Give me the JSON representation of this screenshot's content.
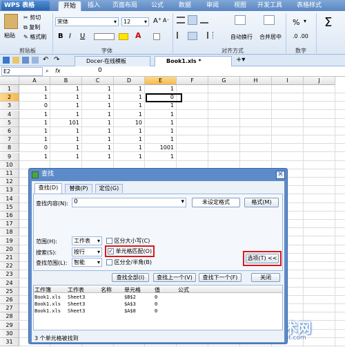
{
  "app": {
    "name": "WPS 表格"
  },
  "ribbon_tabs": [
    "开始",
    "插入",
    "页面布局",
    "公式",
    "数据",
    "审阅",
    "视图",
    "开发工具",
    "表格样式"
  ],
  "ribbon": {
    "paste": "粘贴",
    "cut": "剪切",
    "copy": "复制",
    "format_painter": "格式刷",
    "clipboard_group": "剪贴板",
    "font_group": "字体",
    "align_group": "对齐方式",
    "number_group": "数字",
    "font_name": "宋体",
    "font_size": "12",
    "bold": "B",
    "italic": "I",
    "underline": "U",
    "font_color": "A",
    "wrap": "自动换行",
    "merge": "合并居中",
    "percent": "%",
    "sum": "Σ"
  },
  "doc_tabs": [
    "Docer-在线模板",
    "Book1.xls *"
  ],
  "formula_bar": {
    "name_box": "E2",
    "fx": "fx",
    "value": "0"
  },
  "sheet": {
    "columns": [
      "A",
      "B",
      "C",
      "D",
      "E",
      "F",
      "G",
      "H",
      "I",
      "J"
    ],
    "rows": [
      "1",
      "2",
      "3",
      "4",
      "5",
      "6",
      "7",
      "8",
      "9",
      "10",
      "11",
      "12",
      "13",
      "14",
      "15",
      "16",
      "17",
      "18",
      "19",
      "20",
      "21",
      "22",
      "23",
      "24",
      "25",
      "26",
      "27",
      "28",
      "29",
      "30",
      "31"
    ],
    "data": [
      [
        "1",
        "1",
        "1",
        "1",
        "1"
      ],
      [
        "1",
        "1",
        "1",
        "1",
        "0"
      ],
      [
        "0",
        "1",
        "1",
        "1",
        "1"
      ],
      [
        "1",
        "1",
        "1",
        "1",
        "1"
      ],
      [
        "1",
        "101",
        "1",
        "10",
        "1"
      ],
      [
        "1",
        "1",
        "1",
        "1",
        "1"
      ],
      [
        "1",
        "1",
        "1",
        "1",
        "1"
      ],
      [
        "0",
        "1",
        "1",
        "1",
        "1001"
      ],
      [
        "1",
        "1",
        "1",
        "1",
        "1"
      ]
    ]
  },
  "dialog": {
    "title": "查找",
    "tabs": [
      "查找(D)",
      "替换(P)",
      "定位(G)"
    ],
    "find_label": "查找内容(N):",
    "find_value": "0",
    "no_format": "未设定格式",
    "format_btn": "格式(M)",
    "scope_label": "范围(H):",
    "scope_value": "工作表",
    "search_label": "搜索(S):",
    "search_value": "按行",
    "lookin_label": "查找范围(L):",
    "lookin_value": "智能",
    "match_case": "区分大小写(C)",
    "match_cell": "单元格匹配(O)",
    "match_width": "区分全/半角(B)",
    "options_btn": "选项(T) <<",
    "find_all": "查找全部(I)",
    "find_prev": "查找上一个(V)",
    "find_next": "查找下一个(F)",
    "close": "关闭",
    "result_headers": [
      "工作簿",
      "工作表",
      "名称",
      "单元格",
      "值",
      "公式"
    ],
    "results": [
      [
        "Book1.xls",
        "Sheet3",
        "",
        "$B$2",
        "0",
        ""
      ],
      [
        "Book1.xls",
        "Sheet3",
        "",
        "$A$3",
        "0",
        ""
      ],
      [
        "Book1.xls",
        "Sheet3",
        "",
        "$A$8",
        "0",
        ""
      ]
    ],
    "status": "3 个单元格被找到"
  },
  "watermark": {
    "text": "我爱IT技术网",
    "url": "www.52it.com"
  }
}
